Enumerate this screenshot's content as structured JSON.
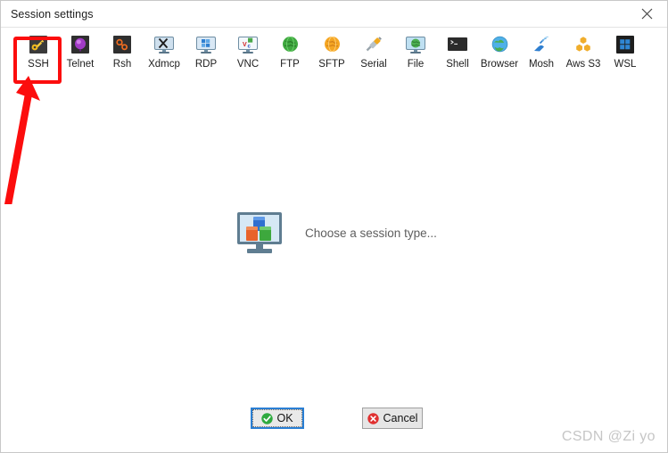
{
  "window": {
    "title": "Session settings",
    "close_label": "×",
    "close_icon": "close-icon"
  },
  "toolbar": {
    "items": [
      {
        "label": "SSH",
        "icon": "ssh-key-icon",
        "selected": true
      },
      {
        "label": "Telnet",
        "icon": "telnet-terminal-icon",
        "selected": false
      },
      {
        "label": "Rsh",
        "icon": "rsh-icon",
        "selected": false
      },
      {
        "label": "Xdmcp",
        "icon": "xdmcp-x-icon",
        "selected": false
      },
      {
        "label": "RDP",
        "icon": "rdp-monitor-icon",
        "selected": false
      },
      {
        "label": "VNC",
        "icon": "vnc-monitor-icon",
        "selected": false
      },
      {
        "label": "FTP",
        "icon": "ftp-globe-icon",
        "selected": false
      },
      {
        "label": "SFTP",
        "icon": "sftp-globe-icon",
        "selected": false
      },
      {
        "label": "Serial",
        "icon": "serial-plug-icon",
        "selected": false
      },
      {
        "label": "File",
        "icon": "file-monitor-icon",
        "selected": false
      },
      {
        "label": "Shell",
        "icon": "shell-console-icon",
        "selected": false
      },
      {
        "label": "Browser",
        "icon": "browser-globe-icon",
        "selected": false
      },
      {
        "label": "Mosh",
        "icon": "mosh-satellite-icon",
        "selected": false
      },
      {
        "label": "Aws S3",
        "icon": "aws-s3-icon",
        "selected": false
      },
      {
        "label": "WSL",
        "icon": "wsl-windows-icon",
        "selected": false
      }
    ]
  },
  "main": {
    "placeholder_text": "Choose a session type...",
    "placeholder_icon": "session-type-monitor-icon"
  },
  "footer": {
    "ok_label": "OK",
    "ok_icon": "green-check-icon",
    "cancel_label": "Cancel",
    "cancel_icon": "red-x-icon"
  },
  "annotation": {
    "highlight_target": "SSH",
    "color": "#fc0d0d"
  },
  "watermark": {
    "text": "CSDN @Zi yo"
  },
  "colors": {
    "accent_blue": "#2a7fd4",
    "annotation_red": "#fc0d0d",
    "ok_green": "#2faa3f",
    "cancel_red": "#e03030",
    "title_text": "#1c1c1c",
    "placeholder_text": "#5e5e5e",
    "watermark": "#c6c6c6"
  }
}
